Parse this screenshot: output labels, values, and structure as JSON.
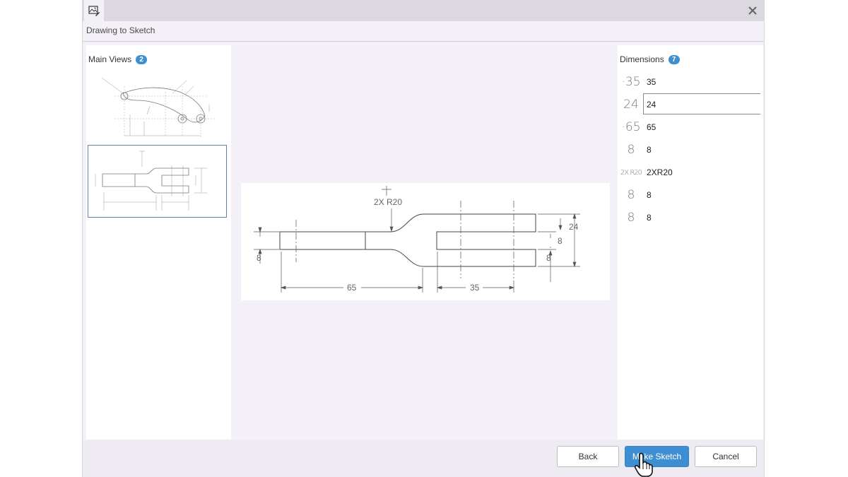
{
  "dialog": {
    "title": "Drawing to Sketch",
    "app_icon": "image-sketch-icon",
    "close_icon": "close-icon"
  },
  "main_views": {
    "label": "Main Views",
    "count": "2",
    "thumbnails": [
      {
        "name": "view-lever-arm",
        "selected": false
      },
      {
        "name": "view-fork-plate",
        "selected": true
      }
    ]
  },
  "drawing": {
    "radius_label": "2X R20",
    "dim_65": "65",
    "dim_35": "35",
    "dim_24": "24",
    "dim_8_left": "8",
    "dim_8_right_top": "8",
    "dim_8_right_bottom": "8"
  },
  "dimensions": {
    "label": "Dimensions",
    "count": "7",
    "items": [
      {
        "glyph": "·35",
        "value": "35",
        "active": false
      },
      {
        "glyph": "24",
        "value": "24",
        "active": true
      },
      {
        "glyph": "·65",
        "value": "65",
        "active": false
      },
      {
        "glyph": "8",
        "value": "8",
        "active": false
      },
      {
        "glyph": "2X R20",
        "value": "2XR20",
        "active": false
      },
      {
        "glyph": "8",
        "value": "8",
        "active": false
      },
      {
        "glyph": "8",
        "value": "8",
        "active": false
      }
    ]
  },
  "buttons": {
    "back": "Back",
    "make_sketch": "Make Sketch",
    "cancel": "Cancel"
  },
  "colors": {
    "accent": "#3d8fd1",
    "dialog_bg": "#f4f0f8"
  }
}
